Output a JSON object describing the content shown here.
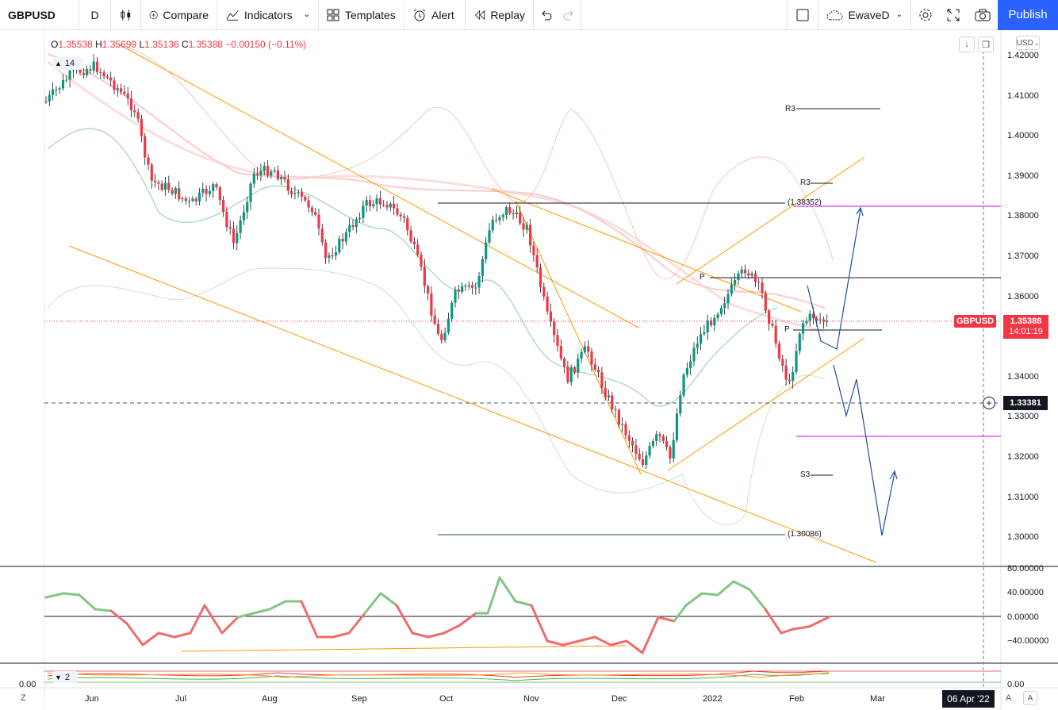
{
  "toolbar": {
    "symbol": "GBPUSD",
    "interval": "D",
    "compare": "Compare",
    "indicators": "Indicators",
    "templates": "Templates",
    "alert": "Alert",
    "replay": "Replay",
    "layout_name": "EwaveD",
    "publish": "Publish"
  },
  "legend": {
    "o_label": "O",
    "o": "1.35538",
    "h_label": "H",
    "h": "1.35699",
    "l_label": "L",
    "l": "1.35136",
    "c_label": "C",
    "c": "1.35388",
    "change": "−0.00150 (−0.11%)",
    "collapse_count": "14",
    "pane2_count": "2"
  },
  "currency": "USD",
  "price_axis": [
    "1.42000",
    "1.41000",
    "1.40000",
    "1.39000",
    "1.38000",
    "1.37000",
    "1.36000",
    "1.35000",
    "1.34000",
    "1.33000",
    "1.32000",
    "1.31000",
    "1.30000"
  ],
  "osc_axis": [
    "80.00000",
    "40.00000",
    "0.00000",
    "−40.00000"
  ],
  "pane2_axis": "0.00",
  "pane2_left_zero": "0.00",
  "time_axis": [
    "Jun",
    "Jul",
    "Aug",
    "Sep",
    "Oct",
    "Nov",
    "Dec",
    "2022",
    "Feb",
    "Mar"
  ],
  "date_marker": "06 Apr '22",
  "tags": {
    "symbol": "GBPUSD",
    "last_price": "1.35388",
    "countdown": "14:01:19",
    "crosshair_price": "1.33381"
  },
  "annotations": {
    "fib_high": "(1.38352)",
    "fib_low": "(1.30086)",
    "r3_upper": "R3",
    "r3_lower": "R3",
    "s3": "S3",
    "pivot_1": "P",
    "pivot_2": "P"
  },
  "corner_left": "Z",
  "corner_right": "A",
  "corner_tz": "A",
  "colors": {
    "up": "#089981",
    "down": "#f23645",
    "trendline": "#ff9800",
    "accent": "#2962ff",
    "projection": "#1f4e9c",
    "level_magenta": "#d500f9"
  },
  "chart_data": {
    "type": "candlestick",
    "symbol": "GBPUSD",
    "ylim": [
      1.298,
      1.424
    ],
    "last": {
      "open": 1.35538,
      "high": 1.35699,
      "low": 1.35136,
      "close": 1.35388,
      "change": -0.0015,
      "change_pct": -0.11
    },
    "levels": [
      1.38352,
      1.30086
    ],
    "oscillator": {
      "ylim": [
        -60,
        80
      ],
      "ticks": [
        80,
        40,
        0,
        -40
      ]
    }
  }
}
